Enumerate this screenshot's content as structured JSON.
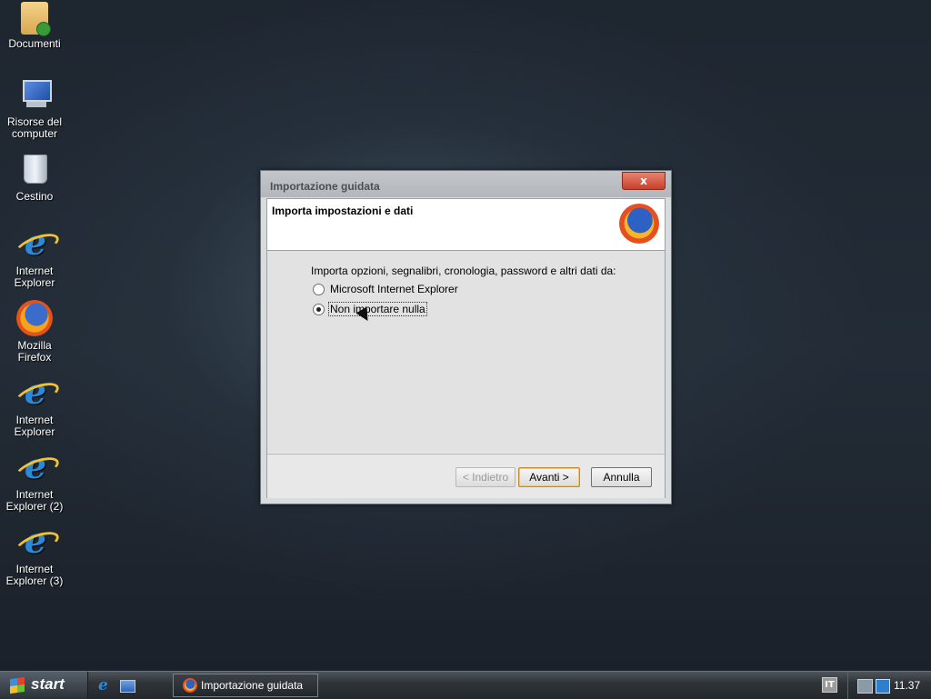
{
  "desktop": {
    "icons": [
      {
        "label": "Documenti"
      },
      {
        "label": "Risorse del computer"
      },
      {
        "label": "Cestino"
      },
      {
        "label": "Internet Explorer"
      },
      {
        "label": "Mozilla Firefox"
      },
      {
        "label": "Internet Explorer"
      },
      {
        "label": "Internet Explorer (2)"
      },
      {
        "label": "Internet Explorer (3)"
      }
    ]
  },
  "dialog": {
    "title": "Importazione guidata",
    "close_label": "x",
    "header_title": "Importa impostazioni e dati",
    "prompt": "Importa opzioni, segnalibri, cronologia, password e altri dati da:",
    "options": [
      {
        "label": "Microsoft Internet Explorer",
        "selected": false
      },
      {
        "label": "Non importare nulla",
        "selected": true
      }
    ],
    "buttons": {
      "back": "< Indietro",
      "next": "Avanti >",
      "cancel": "Annulla"
    }
  },
  "taskbar": {
    "start_label": "start",
    "task_label": "Importazione guidata",
    "language": "IT",
    "clock": "11.37"
  }
}
